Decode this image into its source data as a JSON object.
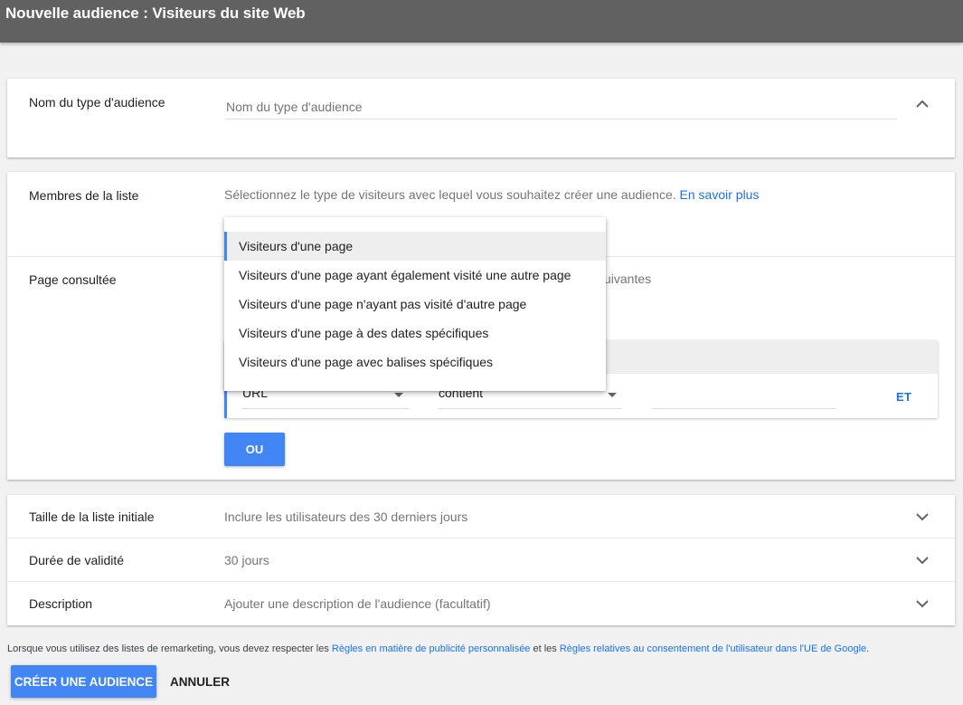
{
  "header": {
    "title": "Nouvelle audience : Visiteurs du site Web"
  },
  "audience_name": {
    "label": "Nom du type d'audience",
    "placeholder": "Nom du type d'audience",
    "value": "",
    "toggle_icon": "chevron-up-icon"
  },
  "list_members": {
    "label": "Membres de la liste",
    "description": "Sélectionnez le type de visiteurs avec lequel vous souhaitez créer une audience.",
    "learn_more": "En savoir plus",
    "dropdown": {
      "options": [
        "Visiteurs d'une page",
        "Visiteurs d'une page ayant également visité une autre page",
        "Visiteurs d'une page n'ayant pas visité d'autre page",
        "Visiteurs d'une page à des dates spécifiques",
        "Visiteurs d'une page avec balises spécifiques"
      ],
      "selected_index": 0
    }
  },
  "page_visited": {
    "label": "Page consultée",
    "partial_text": "uivantes",
    "rule": {
      "field": "URL",
      "operator": "contient",
      "value": "",
      "and_label": "ET"
    },
    "or_label": "OU"
  },
  "options": [
    {
      "label": "Taille de la liste initiale",
      "value": "Inclure les utilisateurs des 30 derniers jours"
    },
    {
      "label": "Durée de validité",
      "value": "30 jours"
    },
    {
      "label": "Description",
      "value": "Ajouter une description de l'audience (facultatif)"
    }
  ],
  "footer": {
    "note_prefix": "Lorsque vous utilisez des listes de remarketing, vous devez respecter les ",
    "link1": "Règles en matière de publicité personnalisée",
    "note_mid": " et les ",
    "link2": "Règles relatives au consentement de l'utilisateur dans l'UE de Google",
    "note_suffix": ".",
    "create_label": "CRÉER UNE AUDIENCE",
    "cancel_label": "ANNULER"
  },
  "colors": {
    "header": "#616161",
    "accent": "#4285f4",
    "link": "#1a73e8"
  }
}
